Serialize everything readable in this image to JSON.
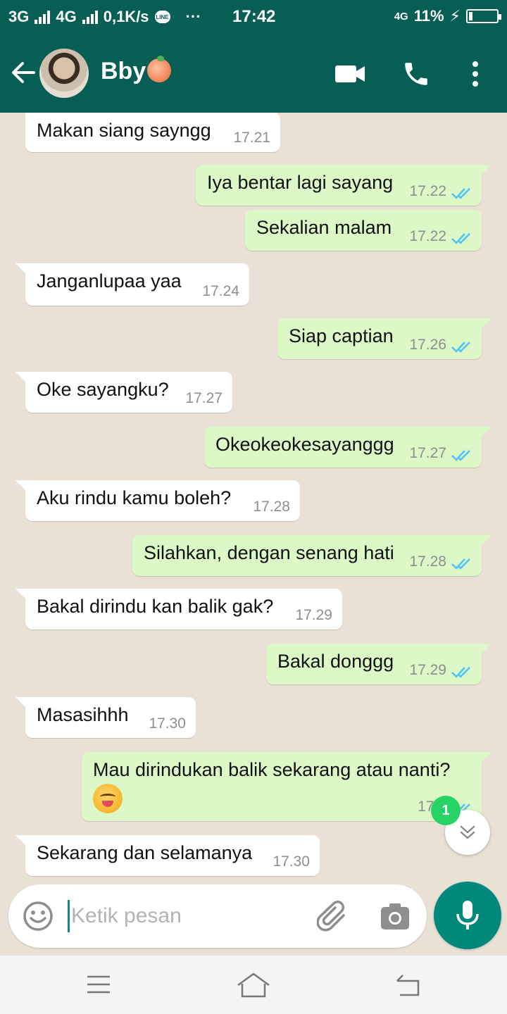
{
  "status_bar": {
    "network_1": "3G",
    "network_2": "4G",
    "speed": "0,1K/s",
    "line_label": "LINE",
    "more": "···",
    "time": "17:42",
    "net_type": "4G",
    "battery": "11%"
  },
  "header": {
    "contact_name": "Bby"
  },
  "messages": [
    {
      "dir": "in",
      "text": "Makan siang sayngg",
      "time": "17.21"
    },
    {
      "dir": "out",
      "text": "Iya bentar lagi sayang",
      "time": "17.22"
    },
    {
      "dir": "out",
      "text": "Sekalian malam",
      "time": "17.22"
    },
    {
      "dir": "in",
      "text": "Janganlupaa yaa",
      "time": "17.24"
    },
    {
      "dir": "out",
      "text": "Siap captian",
      "time": "17.26"
    },
    {
      "dir": "in",
      "text": "Oke sayangku?",
      "time": "17.27"
    },
    {
      "dir": "out",
      "text": "Okeokeokesayanggg",
      "time": "17.27"
    },
    {
      "dir": "in",
      "text": "Aku rindu kamu boleh?",
      "time": "17.28"
    },
    {
      "dir": "out",
      "text": "Silahkan, dengan senang hati",
      "time": "17.28"
    },
    {
      "dir": "in",
      "text": "Bakal dirindu kan balik gak?",
      "time": "17.29"
    },
    {
      "dir": "out",
      "text": "Bakal donggg",
      "time": "17.29"
    },
    {
      "dir": "in",
      "text": "Masasihhh",
      "time": "17.30"
    },
    {
      "dir": "out",
      "text": "Mau dirindukan balik sekarang atau nanti?",
      "time": "17.3"
    },
    {
      "dir": "in",
      "text": "Sekarang dan selamanya",
      "time": "17.30"
    }
  ],
  "unread_count": "1",
  "composer": {
    "placeholder": "Ketik pesan"
  },
  "colors": {
    "header": "#075e54",
    "outgoing_bubble": "#dcf8c6",
    "incoming_bubble": "#ffffff",
    "read_ticks": "#4fc3f7",
    "mic_button": "#00897b",
    "unread_badge": "#25d366"
  }
}
